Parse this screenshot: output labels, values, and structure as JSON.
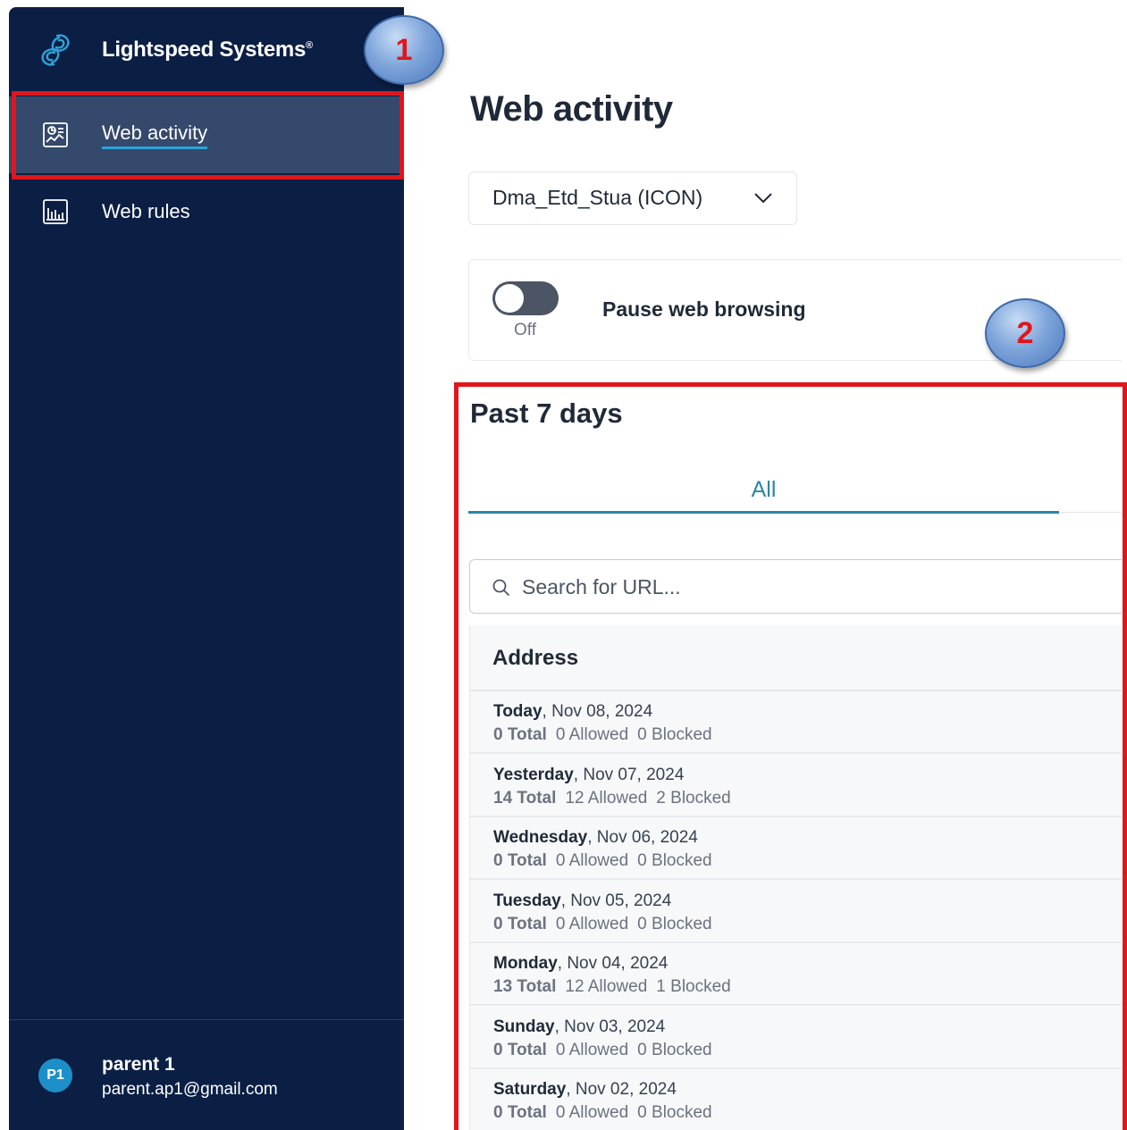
{
  "brand": {
    "name": "Lightspeed Systems",
    "mark": "®"
  },
  "nav": [
    {
      "label": "Web activity",
      "icon": "activity-chart-icon",
      "active": true
    },
    {
      "label": "Web rules",
      "icon": "bar-chart-icon",
      "active": false
    }
  ],
  "user": {
    "initials": "P1",
    "name": "parent 1",
    "email": "parent.ap1@gmail.com"
  },
  "annotations": {
    "badge1": "1",
    "badge2": "2"
  },
  "main": {
    "title": "Web activity",
    "child_select": {
      "value": "Dma_Etd_Stua (ICON)"
    },
    "pause": {
      "label": "Pause web browsing",
      "state": "Off"
    },
    "section_title": "Past 7 days",
    "tabs": [
      {
        "label": "All"
      }
    ],
    "search": {
      "placeholder": "Search for URL..."
    },
    "table": {
      "header": "Address",
      "rows": [
        {
          "day": "Today",
          "date": ", Nov 08, 2024",
          "total": "0 Total",
          "allowed": "0 Allowed",
          "blocked": "0 Blocked"
        },
        {
          "day": "Yesterday",
          "date": ", Nov 07, 2024",
          "total": "14 Total",
          "allowed": "12 Allowed",
          "blocked": "2 Blocked"
        },
        {
          "day": "Wednesday",
          "date": ", Nov 06, 2024",
          "total": "0 Total",
          "allowed": "0 Allowed",
          "blocked": "0 Blocked"
        },
        {
          "day": "Tuesday",
          "date": ", Nov 05, 2024",
          "total": "0 Total",
          "allowed": "0 Allowed",
          "blocked": "0 Blocked"
        },
        {
          "day": "Monday",
          "date": ", Nov 04, 2024",
          "total": "13 Total",
          "allowed": "12 Allowed",
          "blocked": "1 Blocked"
        },
        {
          "day": "Sunday",
          "date": ", Nov 03, 2024",
          "total": "0 Total",
          "allowed": "0 Allowed",
          "blocked": "0 Blocked"
        },
        {
          "day": "Saturday",
          "date": ", Nov 02, 2024",
          "total": "0 Total",
          "allowed": "0 Allowed",
          "blocked": "0 Blocked"
        }
      ]
    }
  },
  "colors": {
    "sidebar": "#0b1f45",
    "active_nav": "#34496b",
    "accent": "#2c86a7",
    "annotation_red": "#e0161b"
  }
}
